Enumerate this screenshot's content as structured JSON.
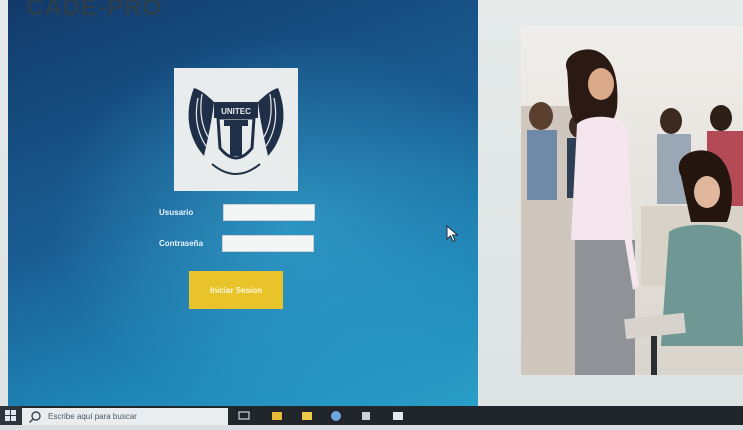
{
  "app": {
    "title": "CADE-PRO"
  },
  "logo": {
    "text": "UNITEC",
    "motto": "CIENCIA Y TÉCNICA CON HUMANISMO"
  },
  "form": {
    "username_label": "Ususario",
    "username_value": "",
    "password_label": "Contraseña",
    "password_value": "",
    "login_button": "Iniciar Sesion"
  },
  "taskbar": {
    "search_placeholder": "Escribe aquí para buscar",
    "icons": [
      "windows-icon",
      "task-view-icon",
      "file-explorer-icon",
      "folder-icon",
      "browser-icon",
      "app-icon",
      "store-icon"
    ]
  },
  "colors": {
    "panel_top": "#123a6b",
    "panel_bottom": "#2aa0c8",
    "button": "#e8c32a",
    "title": "#2b3f4f",
    "taskbar": "#20262c"
  }
}
